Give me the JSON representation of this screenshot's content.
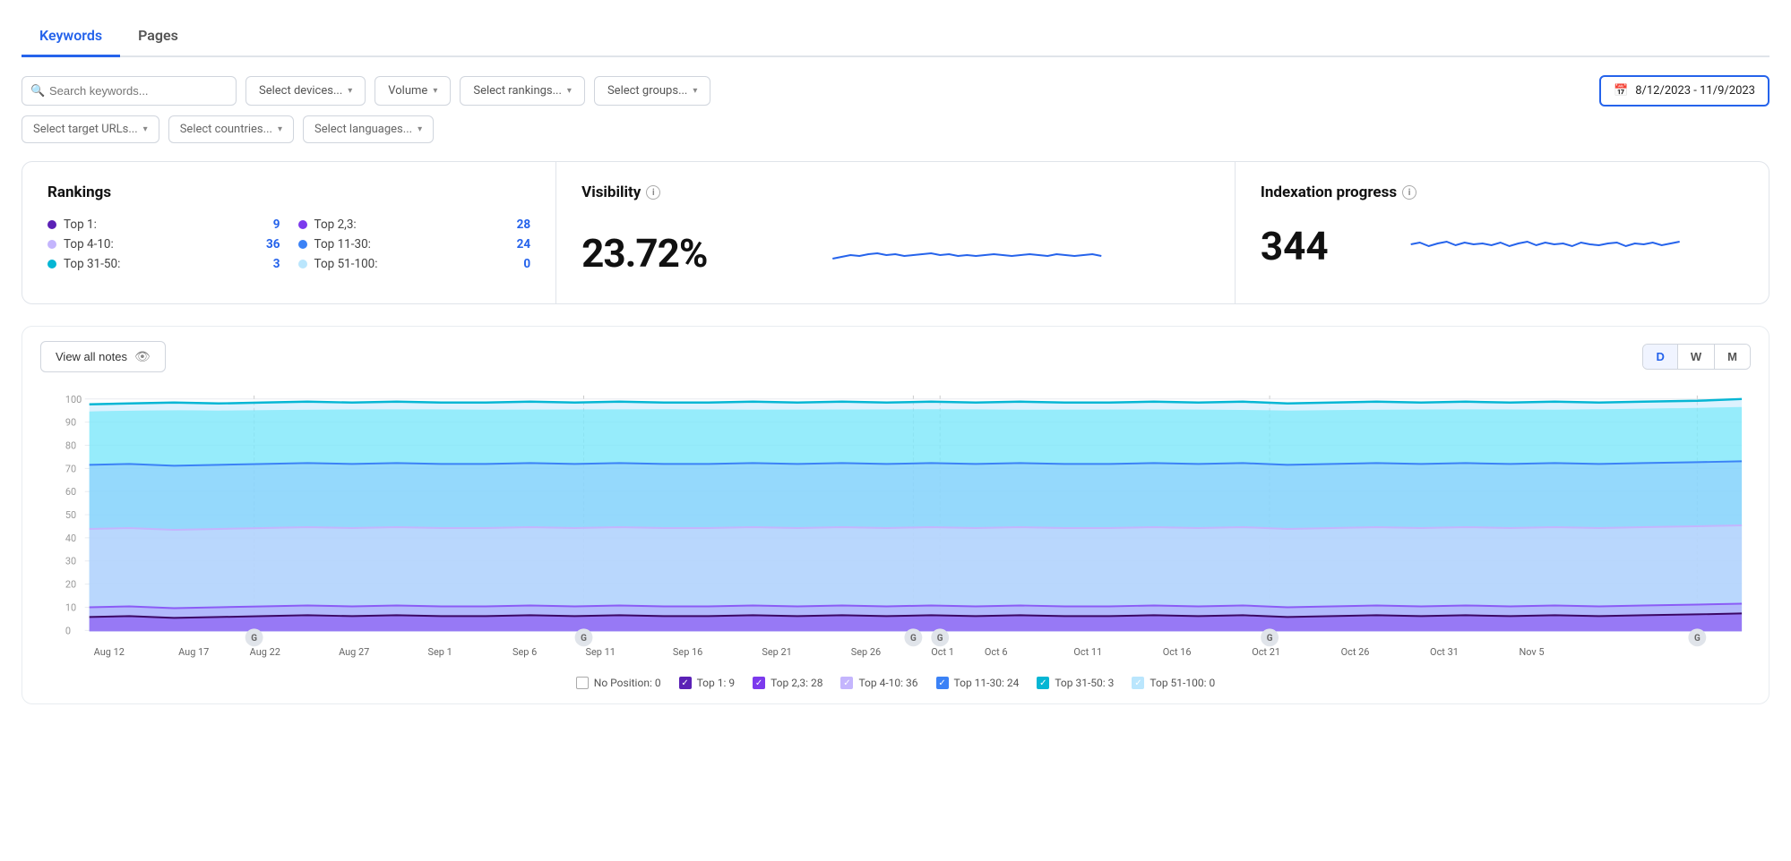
{
  "tabs": [
    {
      "label": "Keywords",
      "active": true
    },
    {
      "label": "Pages",
      "active": false
    }
  ],
  "filters": {
    "search_placeholder": "Search keywords...",
    "devices_label": "Select devices...",
    "volume_label": "Volume",
    "rankings_label": "Select rankings...",
    "groups_label": "Select groups...",
    "date_range": "8/12/2023 - 11/9/2023",
    "target_urls_label": "Select target URLs...",
    "countries_label": "Select countries...",
    "languages_label": "Select languages..."
  },
  "rankings_card": {
    "title": "Rankings",
    "items": [
      {
        "label": "Top 1:",
        "value": "9",
        "color": "#5b21b6"
      },
      {
        "label": "Top 2,3:",
        "value": "28",
        "color": "#7c3aed"
      },
      {
        "label": "Top 4-10:",
        "value": "36",
        "color": "#c4b5fd"
      },
      {
        "label": "Top 11-30:",
        "value": "24",
        "color": "#3b82f6"
      },
      {
        "label": "Top 31-50:",
        "value": "3",
        "color": "#06b6d4"
      },
      {
        "label": "Top 51-100:",
        "value": "0",
        "color": "#bae6fd"
      }
    ]
  },
  "visibility_card": {
    "title": "Visibility",
    "value": "23.72%"
  },
  "indexation_card": {
    "title": "Indexation progress",
    "value": "344"
  },
  "chart": {
    "view_notes_label": "View all notes",
    "periods": [
      "D",
      "W",
      "M"
    ],
    "active_period": "D",
    "y_labels": [
      "100",
      "90",
      "80",
      "70",
      "60",
      "50",
      "40",
      "30",
      "20",
      "10",
      "0"
    ],
    "x_labels": [
      "Aug 12",
      "Aug 17",
      "Aug 22",
      "Aug 27",
      "Sep 1",
      "Sep 6",
      "Sep 11",
      "Sep 16",
      "Sep 21",
      "Sep 26",
      "Oct 1",
      "Oct 6",
      "Oct 11",
      "Oct 16",
      "Oct 21",
      "Oct 26",
      "Oct 31",
      "Nov 5"
    ]
  },
  "legend": [
    {
      "label": "No Position: 0",
      "color": "#fff",
      "border": "#aaa",
      "checked": false
    },
    {
      "label": "Top 1: 9",
      "color": "#5b21b6",
      "checked": true
    },
    {
      "label": "Top 2,3: 28",
      "color": "#7c3aed",
      "checked": true
    },
    {
      "label": "Top 4-10: 36",
      "color": "#c4b5fd",
      "checked": true
    },
    {
      "label": "Top 11-30: 24",
      "color": "#3b82f6",
      "checked": true
    },
    {
      "label": "Top 31-50: 3",
      "color": "#06b6d4",
      "checked": true
    },
    {
      "label": "Top 51-100: 0",
      "color": "#bae6fd",
      "checked": true
    }
  ],
  "icons": {
    "search": "🔍",
    "calendar": "📅",
    "eye_off": "👁",
    "chevron_down": "▾"
  }
}
